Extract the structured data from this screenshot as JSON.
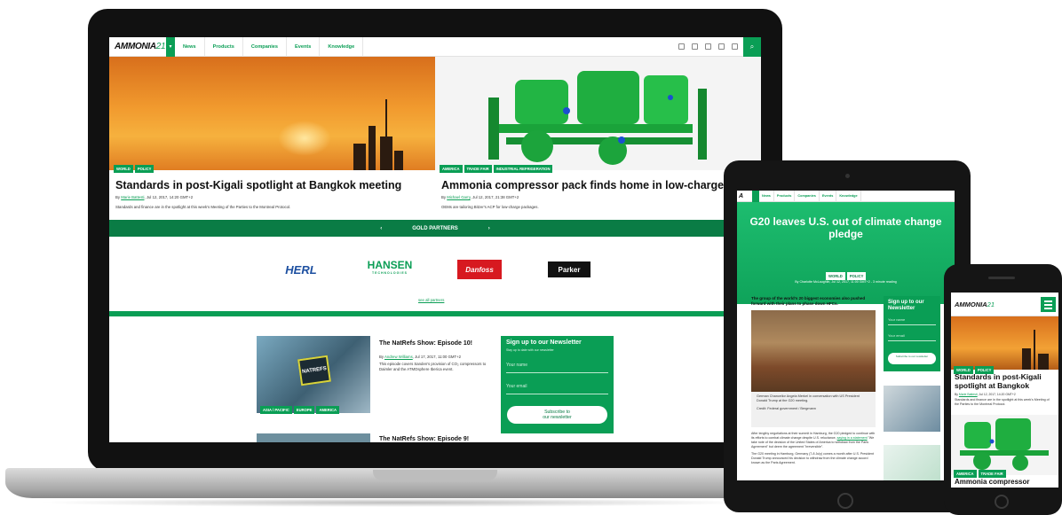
{
  "brand": {
    "logo_main": "AMMONIA",
    "logo_num": "21",
    "accent": "#0a9e55",
    "accent_dark": "#0a7c45"
  },
  "laptop": {
    "nav": {
      "items": [
        "News",
        "Products",
        "Companies",
        "Events",
        "Knowledge"
      ]
    },
    "social_icons": [
      "facebook-icon",
      "twitter-icon",
      "linkedin-icon",
      "instagram-icon",
      "youtube-icon"
    ],
    "articles": [
      {
        "tags": [
          "WORLD",
          "POLICY"
        ],
        "title": "Standards in post-Kigali spotlight at Bangkok meeting",
        "by": "By",
        "author": "Marie Battesti",
        "date": ", Jul 12, 2017, 14:20 GMT+2",
        "excerpt": "Standards and finance are in the spotlight at this week's Meeting of the Parties to the Montreal Protocol."
      },
      {
        "tags": [
          "AMERICA",
          "TRADE FAIR",
          "INDUSTRIAL REFRIGERATION"
        ],
        "title": "Ammonia compressor pack finds home in low-charge un",
        "by": "By",
        "author": "Michael Garry",
        "date": ", Jul 12, 2017, 21:38 GMT+2",
        "excerpt": "OEMs are tailoring Bitzer's ACP for low-charge packages."
      }
    ],
    "partners": {
      "prev": "‹",
      "label": "GOLD PARTNERS",
      "next": "›",
      "logos": [
        "HERL",
        "HANSEN",
        "Danfoss",
        "Parker"
      ],
      "hansen_sub": "TECHNOLOGIES",
      "see_all": "see all partners"
    },
    "podcasts": [
      {
        "title": "The NatRefs Show: Episode 10!",
        "by": "By",
        "author": "Andrew Williams",
        "date": ", Jul 17, 2017, 11:00 GMT+2",
        "excerpt": "This episode covers Sanden's provision of CO₂ compressors to Daimler and the ATMOsphere Iberica event.",
        "tags": [
          "ASIA / PACIFIC",
          "EUROPE",
          "AMERICA"
        ],
        "badge": "NATREFS"
      },
      {
        "title": "The NatRefs Show: Episode 9!"
      }
    ],
    "newsletter": {
      "title": "Sign up to our Newsletter",
      "sub": "Stay up to date with our newsletter",
      "name_placeholder": "Your name",
      "email_placeholder": "Your email",
      "button_line1": "Subscribe to",
      "button_line2": "our newsletter"
    }
  },
  "tablet": {
    "nav": {
      "logo": "A",
      "items": [
        "News",
        "Products",
        "Companies",
        "Events",
        "Knowledge"
      ]
    },
    "headline": "G20 leaves U.S. out of climate change pledge",
    "tags": [
      "WORLD",
      "POLICY"
    ],
    "meta": "By Charlotte McLaughlin, Jul 12, 2017, 11:00 GMT+2 - 3 minute reading",
    "lead": "The group of the world's 20 biggest economies also pushed forward with their plans to phase down HFCs.",
    "caption": "German Chancellor Angela Merkel in conversation with US President Donald Trump at the G20 meeting.",
    "credit": "Credit: Federal government / Bergmann",
    "body1": "After lengthy negotiations at their summit in Hamburg, the G20 pledged to continue with its efforts to combat climate change despite U.S. reluctance,",
    "body_link": "saying in a statement",
    "body2": " \"We take note of the decision of the United States of America to withdraw from the Paris Agreement\" but deem the agreement \"irreversible\".",
    "body3": "The G20 meeting in Hamburg, Germany (7-8 July) comes a month after U.S. President Donald Trump announced his decision to withdraw from the climate change accord known as the Paris Agreement.",
    "newsletter": {
      "title": "Sign up to our Newsletter",
      "name_placeholder": "Your name",
      "email_placeholder": "Your email",
      "button": "Subscribe to our newsletter"
    }
  },
  "phone": {
    "logo_main": "AMMONIA",
    "logo_num": "21",
    "tags": [
      "WORLD",
      "POLICY"
    ],
    "title": "Standards in post-Kigali spotlight at Bangkok",
    "by": "By",
    "author": "Marie Battesti",
    "date": ", Jul 12, 2017, 14:20 GMT+2",
    "excerpt": "Standards and finance are in the spotlight at this week's Meeting of the Parties to the Montreal Protocol.",
    "tags2": [
      "AMERICA",
      "TRADE FAIR"
    ],
    "title2": "Ammonia compressor"
  }
}
